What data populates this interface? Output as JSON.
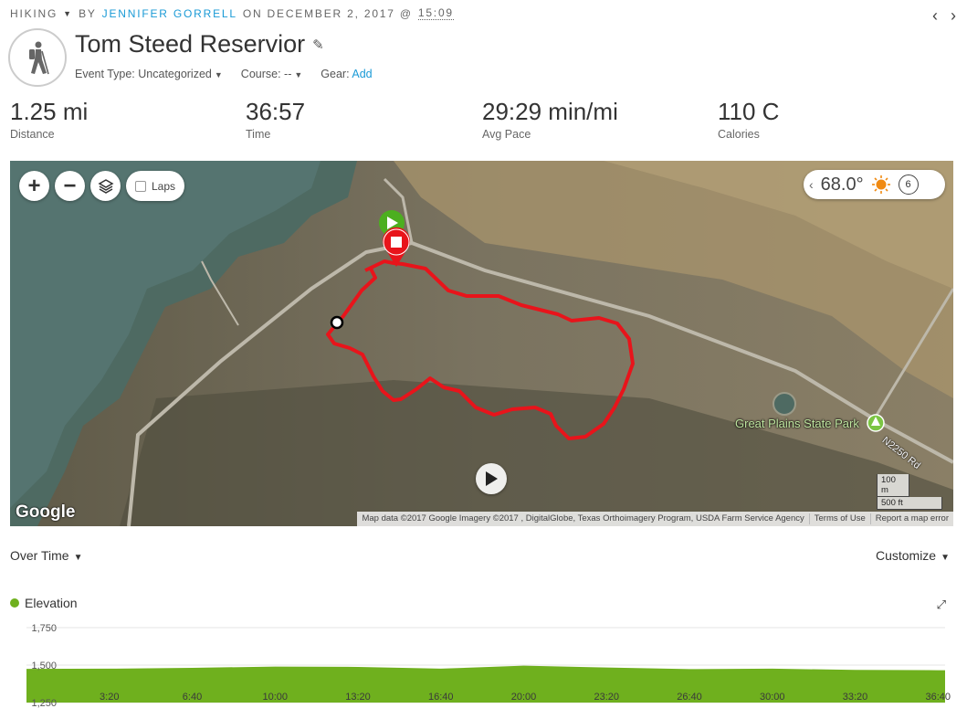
{
  "header": {
    "activity_type": "HIKING",
    "by_label": "BY",
    "author": "JENNIFER GORRELL",
    "on_label": "ON DECEMBER 2, 2017 @",
    "time": "15:09",
    "prev_icon": "chevron-left-icon",
    "next_icon": "chevron-right-icon"
  },
  "title": "Tom Steed Reservior",
  "details": {
    "event_type": "Event Type: Uncategorized",
    "course": "Course: --",
    "gear_label": "Gear:",
    "gear_link": "Add"
  },
  "stats": [
    {
      "value": "1.25 mi",
      "label": "Distance"
    },
    {
      "value": "36:57",
      "label": "Time"
    },
    {
      "value": "29:29 min/mi",
      "label": "Avg Pace"
    },
    {
      "value": "110 C",
      "label": "Calories"
    }
  ],
  "map": {
    "zoom_in": "+",
    "zoom_out": "−",
    "laps_label": "Laps",
    "temperature": "68.0°",
    "wind": "6",
    "park_label": "Great Plains State Park",
    "road_label": "N2250 Rd",
    "google_logo": "Google",
    "scale_metric": "100 m",
    "scale_imperial": "500 ft",
    "attribution": "Map data ©2017 Google Imagery ©2017 , DigitalGlobe, Texas Orthoimagery Program, USDA Farm Service Agency",
    "terms": "Terms of Use",
    "report": "Report a map error",
    "colors": {
      "track": "#e8141b",
      "start": "#4caf1f",
      "stop": "#e8141b"
    }
  },
  "chart_controls": {
    "over_time": "Over Time",
    "customize": "Customize"
  },
  "chart_data": {
    "type": "area",
    "series": [
      {
        "name": "Elevation",
        "color": "#6fb01e",
        "x": [
          "0:00",
          "3:20",
          "6:40",
          "10:00",
          "13:20",
          "16:40",
          "20:00",
          "23:20",
          "26:40",
          "30:00",
          "33:20",
          "36:40",
          "36:57"
        ],
        "values": [
          1475,
          1476,
          1482,
          1490,
          1488,
          1476,
          1496,
          1484,
          1473,
          1476,
          1468,
          1466,
          1466
        ]
      }
    ],
    "x_tick_labels": [
      "3:20",
      "6:40",
      "10:00",
      "13:20",
      "16:40",
      "20:00",
      "23:20",
      "26:40",
      "30:00",
      "33:20",
      "36:40"
    ],
    "y_tick_labels": [
      "1,750",
      "1,500",
      "1,250"
    ],
    "y_ticks": [
      1750,
      1500,
      1250
    ],
    "ylim": [
      1250,
      1750
    ],
    "x_range_seconds": [
      0,
      2217
    ],
    "grid": true
  }
}
